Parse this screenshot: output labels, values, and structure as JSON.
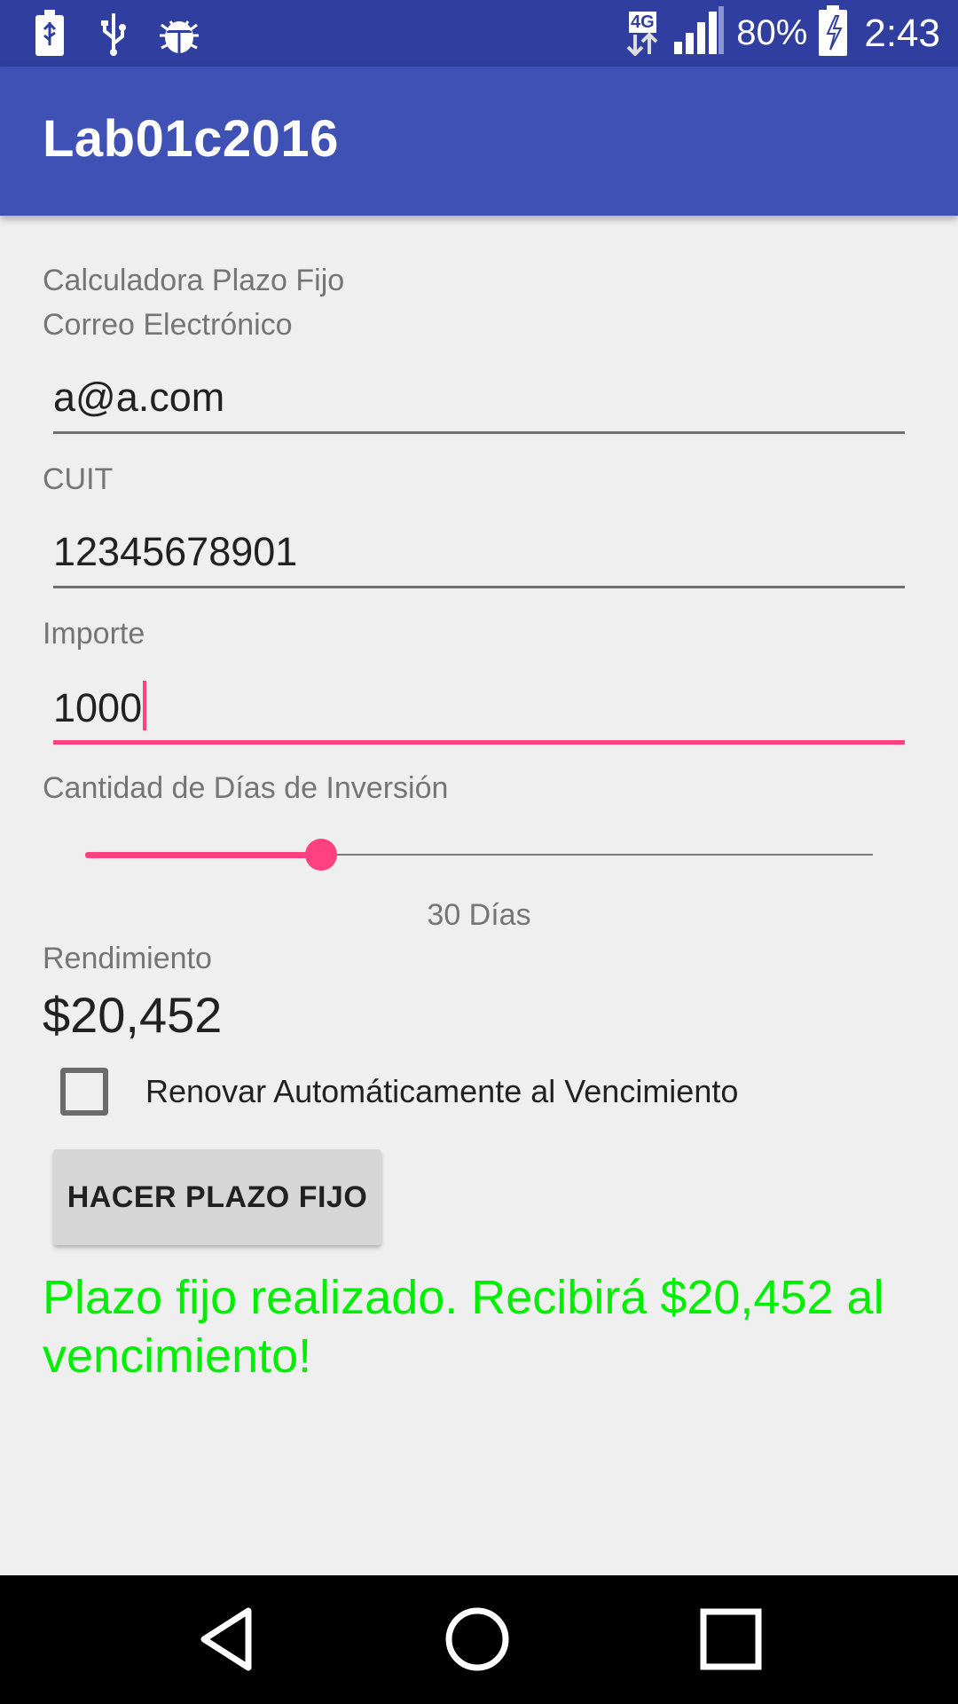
{
  "status_bar": {
    "left_icons": [
      "usb-battery-icon",
      "usb-icon",
      "bug-icon"
    ],
    "network": "4G",
    "battery_percent": "80%",
    "time": "2:43"
  },
  "app_bar": {
    "title": "Lab01c2016"
  },
  "form": {
    "heading": "Calculadora Plazo Fijo",
    "email_label": "Correo Electrónico",
    "email_value": "a@a.com",
    "cuit_label": "CUIT",
    "cuit_value": "12345678901",
    "importe_label": "Importe",
    "importe_value": "1000",
    "days_label": "Cantidad de Días de Inversión",
    "days_slider_fraction": 0.3,
    "days_text": "30 Días",
    "rendimiento_label": "Rendimiento",
    "rendimiento_value": "$20,452",
    "renew_label": "Renovar Automáticamente al Vencimiento",
    "renew_checked": false,
    "submit_label": "HACER PLAZO FIJO",
    "result_message": "Plazo fijo realizado. Recibirá $20,452 al vencimiento!"
  },
  "colors": {
    "status_bar": "#303f9f",
    "app_bar": "#3f51b5",
    "accent": "#ff4081",
    "result": "#00ee00"
  },
  "nav_bar": {
    "buttons": [
      "back-icon",
      "home-icon",
      "recents-icon"
    ]
  }
}
